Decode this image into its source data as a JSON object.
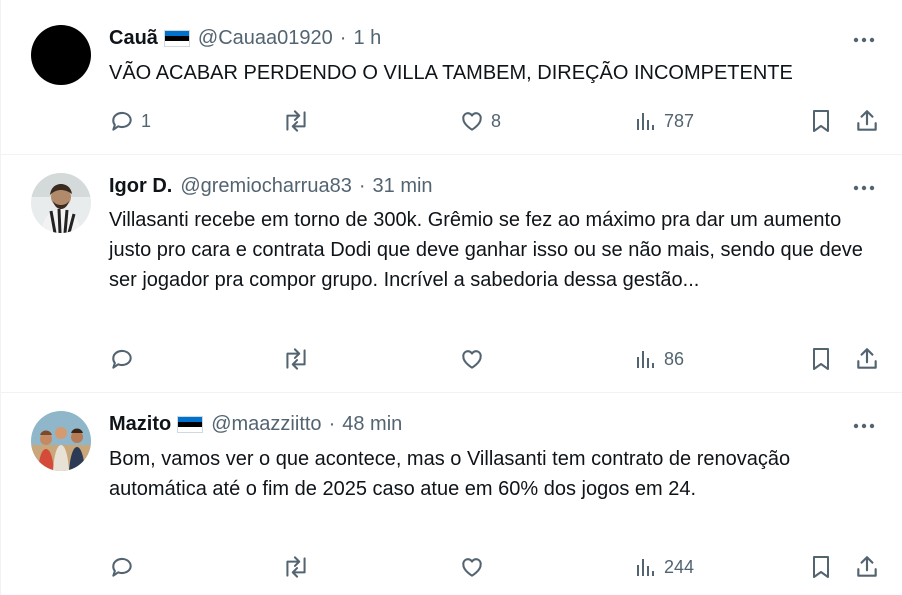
{
  "tweets": [
    {
      "name": "Cauã",
      "handle": "@Cauaa01920",
      "time": "1 h",
      "text": "VÃO ACABAR PERDENDO O VILLA TAMBEM, DIREÇÃO INCOMPETENTE",
      "replies": "1",
      "retweets": "",
      "likes": "8",
      "views": "787",
      "flag": "estonia"
    },
    {
      "name": "Igor D.",
      "handle": "@gremiocharrua83",
      "time": "31 min",
      "text": "Villasanti recebe em torno de 300k. Grêmio se fez ao máximo pra dar um aumento justo pro cara e contrata Dodi que deve ganhar isso ou se não mais, sendo que deve ser jogador pra compor grupo. Incrível a sabedoria dessa gestão...",
      "replies": "",
      "retweets": "",
      "likes": "",
      "views": "86"
    },
    {
      "name": "Mazito",
      "handle": "@maazziitto",
      "time": "48 min",
      "text": "Bom, vamos ver o que acontece, mas o Villasanti tem contrato de renovação automática até o fim de 2025 caso atue em 60% dos jogos em 24.",
      "replies": "",
      "retweets": "",
      "likes": "",
      "views": "244",
      "flag": "estonia"
    }
  ],
  "icons": [
    "reply-icon",
    "retweet-icon",
    "like-icon",
    "views-icon",
    "bookmark-icon",
    "share-icon",
    "more-icon"
  ],
  "colors": {
    "text": "#0f1419",
    "secondary": "#536471",
    "divider": "#eff3f4",
    "flag_blue": "#0072CE",
    "flag_black": "#000000"
  }
}
